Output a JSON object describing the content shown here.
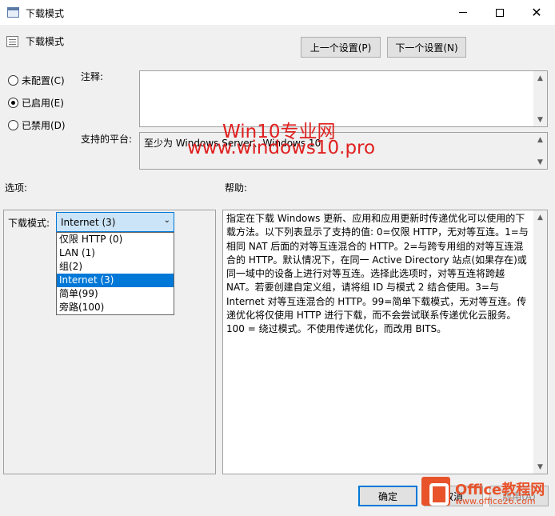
{
  "window": {
    "title": "下载模式",
    "policy_name": "下载模式"
  },
  "nav": {
    "prev_label": "上一个设置(P)",
    "next_label": "下一个设置(N)"
  },
  "state": {
    "options": [
      {
        "label": "未配置(C)",
        "checked": false
      },
      {
        "label": "已启用(E)",
        "checked": true
      },
      {
        "label": "已禁用(D)",
        "checked": false
      }
    ]
  },
  "comment": {
    "label": "注释:",
    "value": ""
  },
  "platform": {
    "label": "支持的平台:",
    "value": "至少为 Windows Server、Windows 10"
  },
  "options_section": {
    "label": "选项:",
    "download_mode_label": "下载模式:",
    "selected": "Internet (3)",
    "choices": [
      "仅限 HTTP (0)",
      "LAN (1)",
      "组(2)",
      "Internet (3)",
      "简单(99)",
      "旁路(100)"
    ]
  },
  "help_section": {
    "label": "帮助:",
    "text": "指定在下载 Windows 更新、应用和应用更新时传递优化可以使用的下载方法。以下列表显示了支持的值: 0=仅限 HTTP，无对等互连。1=与相同 NAT 后面的对等互连混合的 HTTP。2=与跨专用组的对等互连混合的 HTTP。默认情况下，在同一 Active Directory 站点(如果存在)或同一域中的设备上进行对等互连。选择此选项时，对等互连将跨越 NAT。若要创建自定义组，请将组 ID 与模式 2 结合使用。3=与 Internet 对等互连混合的 HTTP。99=简单下载模式，无对等互连。传递优化将仅使用 HTTP 进行下载，而不会尝试联系传递优化云服务。100 = 绕过模式。不使用传递优化，而改用 BITS。"
  },
  "footer": {
    "ok_label": "确定",
    "cancel_label": "取消",
    "apply_label": "应用(A)"
  },
  "watermark": {
    "line1": "Win10专业网",
    "line2": "www.windows10.pro"
  },
  "office_logo": {
    "brand": "Office教程网",
    "url": "www.office26.com"
  }
}
